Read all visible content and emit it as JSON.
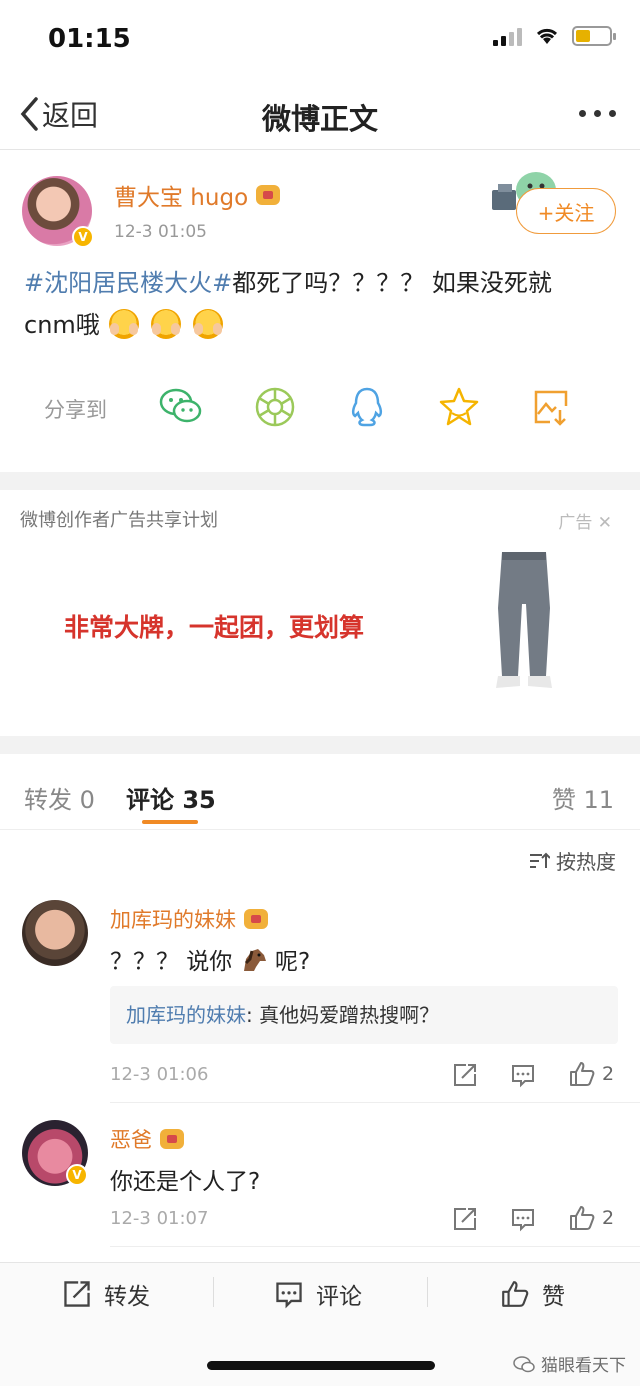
{
  "status_bar": {
    "time": "01:15"
  },
  "nav": {
    "back_label": "返回",
    "title": "微博正文"
  },
  "post": {
    "username": "曹大宝 hugo",
    "time": "12-3 01:05",
    "follow_label": "+关注",
    "hashtag": "#沈阳居民楼大火#",
    "text_line1": "都死了吗？？？？ 如果没死就",
    "text_line2": "cnm哦",
    "share_label": "分享到",
    "share_icons": [
      "wechat-icon",
      "moments-icon",
      "qq-icon",
      "qzone-star-icon",
      "save-image-icon"
    ]
  },
  "ad": {
    "label": "微博创作者广告共享计划",
    "tag": "广告",
    "slogan": "非常大牌，一起团，更划算"
  },
  "tabs": {
    "repost": "转发 0",
    "comments": "评论 35",
    "likes": "赞 11"
  },
  "sort_label": "按热度",
  "comments": [
    {
      "name": "加库玛的妹妹",
      "text_before": "？？？ 说你",
      "text_after": "呢?",
      "reply_name": "加库玛的妹妹",
      "reply_text": ": 真他妈爱蹭热搜啊？",
      "time": "12-3 01:06",
      "likes": "2"
    },
    {
      "name": "恶爸",
      "text": "你还是个人了?",
      "time": "12-3 01:07",
      "likes": "2"
    }
  ],
  "bottom_bar": {
    "repost": "转发",
    "comment": "评论",
    "like": "赞"
  },
  "watermark": "猫眼看天下",
  "colors": {
    "accent_orange": "#f08a25",
    "link_blue": "#507daf",
    "ad_red": "#d6342c"
  }
}
